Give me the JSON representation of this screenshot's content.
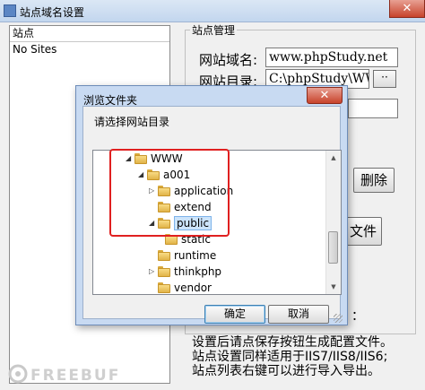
{
  "window": {
    "title": "站点域名设置",
    "close_glyph": "✕"
  },
  "site_list": {
    "header": "站点",
    "rows": [
      "No Sites"
    ]
  },
  "site_manage": {
    "group_title": "站点管理",
    "domain_label": "网站域名:",
    "domain_value": "www.phpStudy.net",
    "dir_label": "网站目录:",
    "dir_value": "C:\\phpStudy\\WWW",
    "browse_label": "··",
    "delete_label": "删除",
    "generate_label": "文件"
  },
  "notes": {
    "line0": "：",
    "line1": "设置后请点保存按钮生成配置文件。",
    "line2": "站点设置同样适用于IIS7/IIS8/IIS6;",
    "line3": "站点列表右键可以进行导入导出。"
  },
  "dialog": {
    "title": "浏览文件夹",
    "close_glyph": "✕",
    "prompt": "请选择网站目录",
    "ok_label": "确定",
    "cancel_label": "取消",
    "tree": [
      {
        "label": "WWW",
        "expanded": true
      },
      {
        "label": "a001",
        "expanded": true
      },
      {
        "label": "application",
        "expanded": false
      },
      {
        "label": "extend",
        "expanded": null
      },
      {
        "label": "public",
        "expanded": true,
        "selected": true
      },
      {
        "label": "static",
        "expanded": null
      },
      {
        "label": "runtime",
        "expanded": null
      },
      {
        "label": "thinkphp",
        "expanded": false
      },
      {
        "label": "vendor",
        "expanded": null
      }
    ]
  },
  "watermark": {
    "text": "FREEBUF"
  },
  "colors": {
    "highlight_box": "#e02020",
    "selection": "#cce4fb",
    "folder": "#f8dc85"
  }
}
